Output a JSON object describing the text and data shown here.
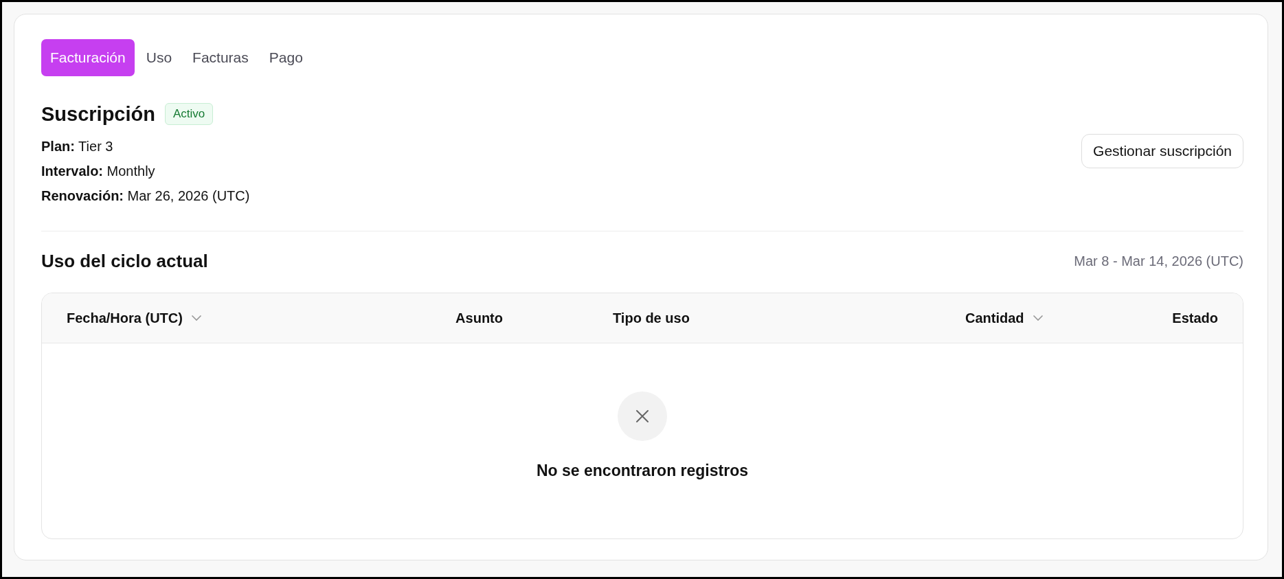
{
  "tabs": [
    {
      "label": "Facturación",
      "selected": true
    },
    {
      "label": "Uso",
      "selected": false
    },
    {
      "label": "Facturas",
      "selected": false
    },
    {
      "label": "Pago",
      "selected": false
    }
  ],
  "subscription": {
    "title": "Suscripción",
    "status": "Activo",
    "details": [
      {
        "label": "Plan:",
        "value": "Tier 3"
      },
      {
        "label": "Intervalo:",
        "value": "Monthly"
      },
      {
        "label": "Renovación:",
        "value": "Mar 26, 2026 (UTC)"
      }
    ],
    "button": "Gestionar suscripción"
  },
  "usage": {
    "title": "Uso del ciclo actual",
    "period": "Mar 8 - Mar 14, 2026 (UTC)",
    "table": {
      "columns": [
        {
          "label": "Fecha/Hora (UTC)",
          "sortable": true
        },
        {
          "label": "Asunto",
          "sortable": false
        },
        {
          "label": "Tipo de uso",
          "sortable": false
        },
        {
          "label": "Cantidad",
          "sortable": true
        },
        {
          "label": "Estado",
          "sortable": false
        }
      ],
      "empty_message": "No se encontraron registros"
    }
  }
}
